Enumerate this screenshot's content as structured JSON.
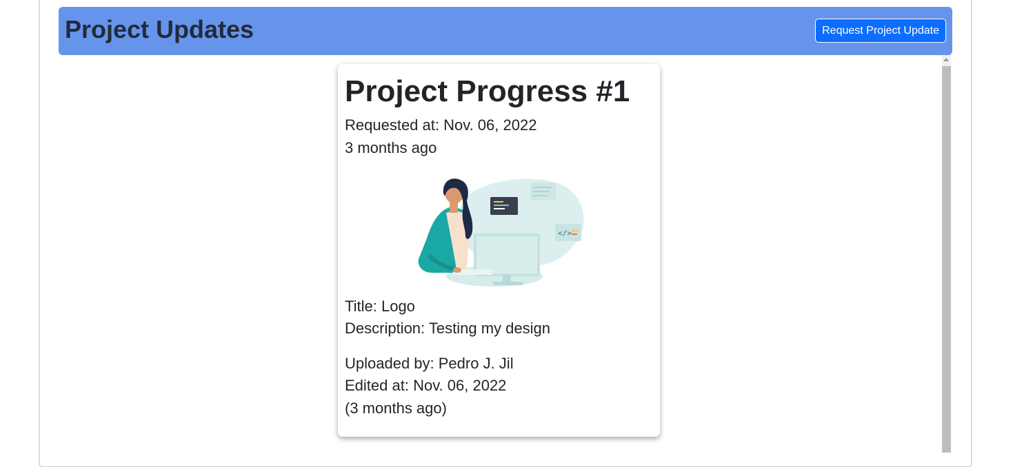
{
  "header": {
    "title": "Project Updates",
    "request_button_label": "Request Project Update"
  },
  "card": {
    "title": "Project Progress #1",
    "requested_at": "Requested at: Nov. 06, 2022",
    "requested_relative": "3 months ago",
    "image_icon": "developer-at-computer-illustration",
    "item_title": "Title: Logo",
    "description": "Description: Testing my design",
    "uploaded_by": "Uploaded by: Pedro J. Jil",
    "edited_at": "Edited at: Nov. 06, 2022",
    "edited_relative": "(3 months ago)"
  },
  "colors": {
    "header_background": "#6694eb",
    "button_background": "#0d6efd",
    "text": "#212529"
  }
}
